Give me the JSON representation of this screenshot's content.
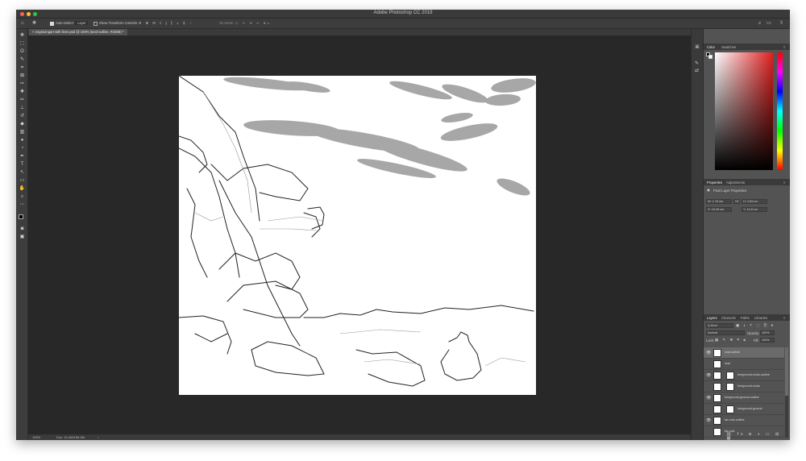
{
  "window": {
    "title": "Adobe Photoshop CC 2019"
  },
  "options_bar": {
    "auto_select_label": "Auto-Select:",
    "auto_select_value": "Layer",
    "show_transform_label": "Show Transform Controls",
    "mode_3d_label": "3D Mode:"
  },
  "document": {
    "tab_title": "engravingart with lines.psd @ 100% (seal-outline, RGB/8) *",
    "zoom": "100%",
    "doc_info": "Doc: 10.4M/196.5M"
  },
  "colors": {
    "window_bg": "#535353",
    "canvas_area": "#282828",
    "panel_dark": "#3a3a3a",
    "selected_layer": "#6a6a6a"
  },
  "color_panel": {
    "tabs": [
      "Color",
      "Swatches"
    ]
  },
  "properties_panel": {
    "tabs": [
      "Properties",
      "Adjustments"
    ],
    "header": "Pixel Layer Properties",
    "W": "W: 1.76 cm",
    "H": "H: 2.84 cm",
    "link_label": "GO",
    "X": "X: 16.28 cm",
    "Y": "Y: 14.8 cm"
  },
  "layers_panel": {
    "tabs": [
      "Layers",
      "Channels",
      "Paths",
      "Libraries"
    ],
    "kind": "Q Kind",
    "blend_mode": "Normal",
    "opacity_label": "Opacity:",
    "opacity_value": "100%",
    "lock_label": "Lock:",
    "fill_label": "Fill:",
    "fill_value": "100%",
    "layers": [
      {
        "name": "seal-outline",
        "visible": true,
        "selected": true,
        "mask": false
      },
      {
        "name": "seal",
        "visible": false,
        "selected": false,
        "mask": false
      },
      {
        "name": "foreground-rocks-outline",
        "visible": true,
        "selected": false,
        "mask": true
      },
      {
        "name": "foreground-rocks",
        "visible": false,
        "selected": false,
        "mask": true
      },
      {
        "name": "foreground-ground-outline",
        "visible": true,
        "selected": false,
        "mask": false
      },
      {
        "name": "foreground-ground",
        "visible": false,
        "selected": false,
        "mask": true
      },
      {
        "name": "far-rock-outline",
        "visible": true,
        "selected": false,
        "mask": false
      },
      {
        "name": "far-rock",
        "visible": false,
        "selected": false,
        "mask": false
      }
    ]
  }
}
